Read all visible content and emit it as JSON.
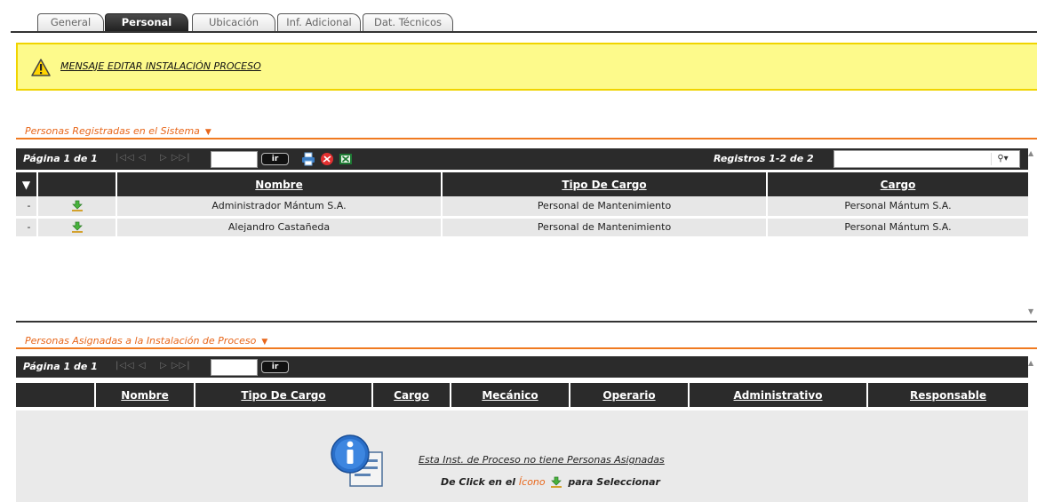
{
  "tabs": [
    {
      "label": "General",
      "active": false
    },
    {
      "label": "Personal",
      "active": true
    },
    {
      "label": "Ubicación",
      "active": false
    },
    {
      "label": "Inf. Adicional",
      "active": false
    },
    {
      "label": "Dat. Técnicos",
      "active": false
    }
  ],
  "message": {
    "text": "MENSAJE EDITAR INSTALACIÓN PROCESO",
    "icon": "warning-icon"
  },
  "registered": {
    "title": "Personas Registradas en el Sistema",
    "page_label": "Página 1 de 1",
    "go_label": "ir",
    "records_label": "Registros 1-2 de 2",
    "search_value": "",
    "columns": [
      "Nombre",
      "Tipo De Cargo",
      "Cargo"
    ],
    "rows": [
      {
        "marker": "-",
        "nombre": "Administrador Mántum S.A.",
        "tipo": "Personal de Mantenimiento",
        "cargo": "Personal Mántum S.A."
      },
      {
        "marker": "-",
        "nombre": "Alejandro Castañeda",
        "tipo": "Personal de Mantenimiento",
        "cargo": "Personal Mántum S.A."
      }
    ]
  },
  "assigned": {
    "title": "Personas Asignadas a la Instalación de Proceso",
    "page_label": "Página 1 de 1",
    "go_label": "ir",
    "columns": [
      "Nombre",
      "Tipo De Cargo",
      "Cargo",
      "Mecánico",
      "Operario",
      "Administrativo",
      "Responsable"
    ],
    "empty_message": "Esta Inst. de Proceso no tiene Personas Asignadas",
    "hint_prefix": "De Click en el",
    "hint_icon_word": "Ícono",
    "hint_suffix": "para Seleccionar"
  },
  "colors": {
    "accent": "#e8671b",
    "header_dark": "#2b2b2b",
    "warning_bg": "#fdfa8b"
  }
}
